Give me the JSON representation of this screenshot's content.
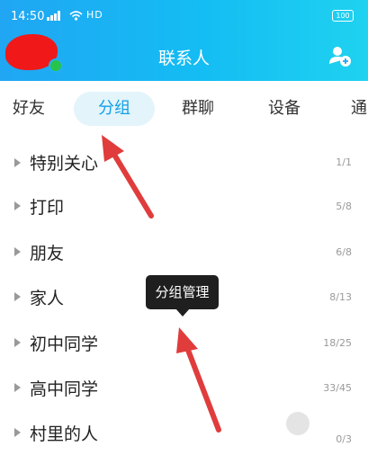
{
  "status_bar": {
    "time": "14:50",
    "signal_text": "HD",
    "battery": "100"
  },
  "header": {
    "title": "联系人"
  },
  "tabs": [
    {
      "label": "好友",
      "active": false
    },
    {
      "label": "分组",
      "active": true
    },
    {
      "label": "群聊",
      "active": false
    },
    {
      "label": "设备",
      "active": false
    },
    {
      "label": "通",
      "active": false
    }
  ],
  "groups": [
    {
      "name": "特别关心",
      "count": "1/1"
    },
    {
      "name": "打印",
      "count": "5/8"
    },
    {
      "name": "朋友",
      "count": "6/8"
    },
    {
      "name": "家人",
      "count": "8/13"
    },
    {
      "name": "初中同学",
      "count": "18/25"
    },
    {
      "name": "高中同学",
      "count": "33/45"
    },
    {
      "name": "村里的人",
      "count": "0/3"
    }
  ],
  "tooltip": {
    "label": "分组管理"
  },
  "colors": {
    "header": "#14bdf3",
    "accent": "#12a0e6",
    "arrow": "#e03c3c"
  }
}
